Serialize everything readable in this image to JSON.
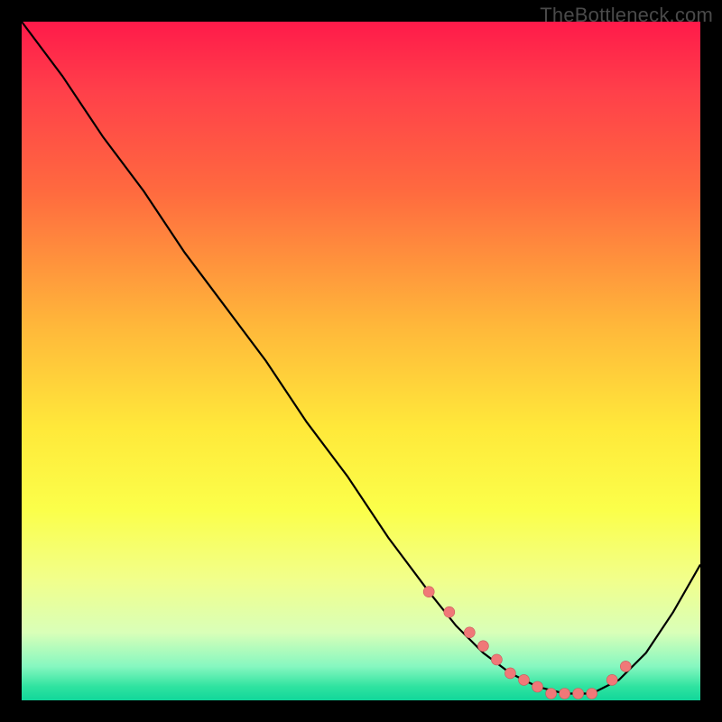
{
  "attribution": "TheBottleneck.com",
  "colors": {
    "gradient_top": "#ff1a4a",
    "gradient_bottom": "#11d69a",
    "line": "#000000",
    "dot_fill": "#f07878",
    "dot_stroke": "#c85a5a",
    "frame_bg": "#000000"
  },
  "chart_data": {
    "type": "line",
    "title": "",
    "xlabel": "",
    "ylabel": "",
    "xlim": [
      0,
      100
    ],
    "ylim": [
      0,
      100
    ],
    "series": [
      {
        "name": "curve",
        "x": [
          0,
          6,
          12,
          18,
          24,
          30,
          36,
          42,
          48,
          54,
          60,
          64,
          68,
          72,
          76,
          80,
          84,
          88,
          92,
          96,
          100
        ],
        "y": [
          100,
          92,
          83,
          75,
          66,
          58,
          50,
          41,
          33,
          24,
          16,
          11,
          7,
          4,
          2,
          1,
          1,
          3,
          7,
          13,
          20
        ]
      }
    ],
    "markers": {
      "name": "highlight-dots",
      "x": [
        60,
        63,
        66,
        68,
        70,
        72,
        74,
        76,
        78,
        80,
        82,
        84,
        87,
        89
      ],
      "y": [
        16,
        13,
        10,
        8,
        6,
        4,
        3,
        2,
        1,
        1,
        1,
        1,
        3,
        5
      ]
    }
  }
}
